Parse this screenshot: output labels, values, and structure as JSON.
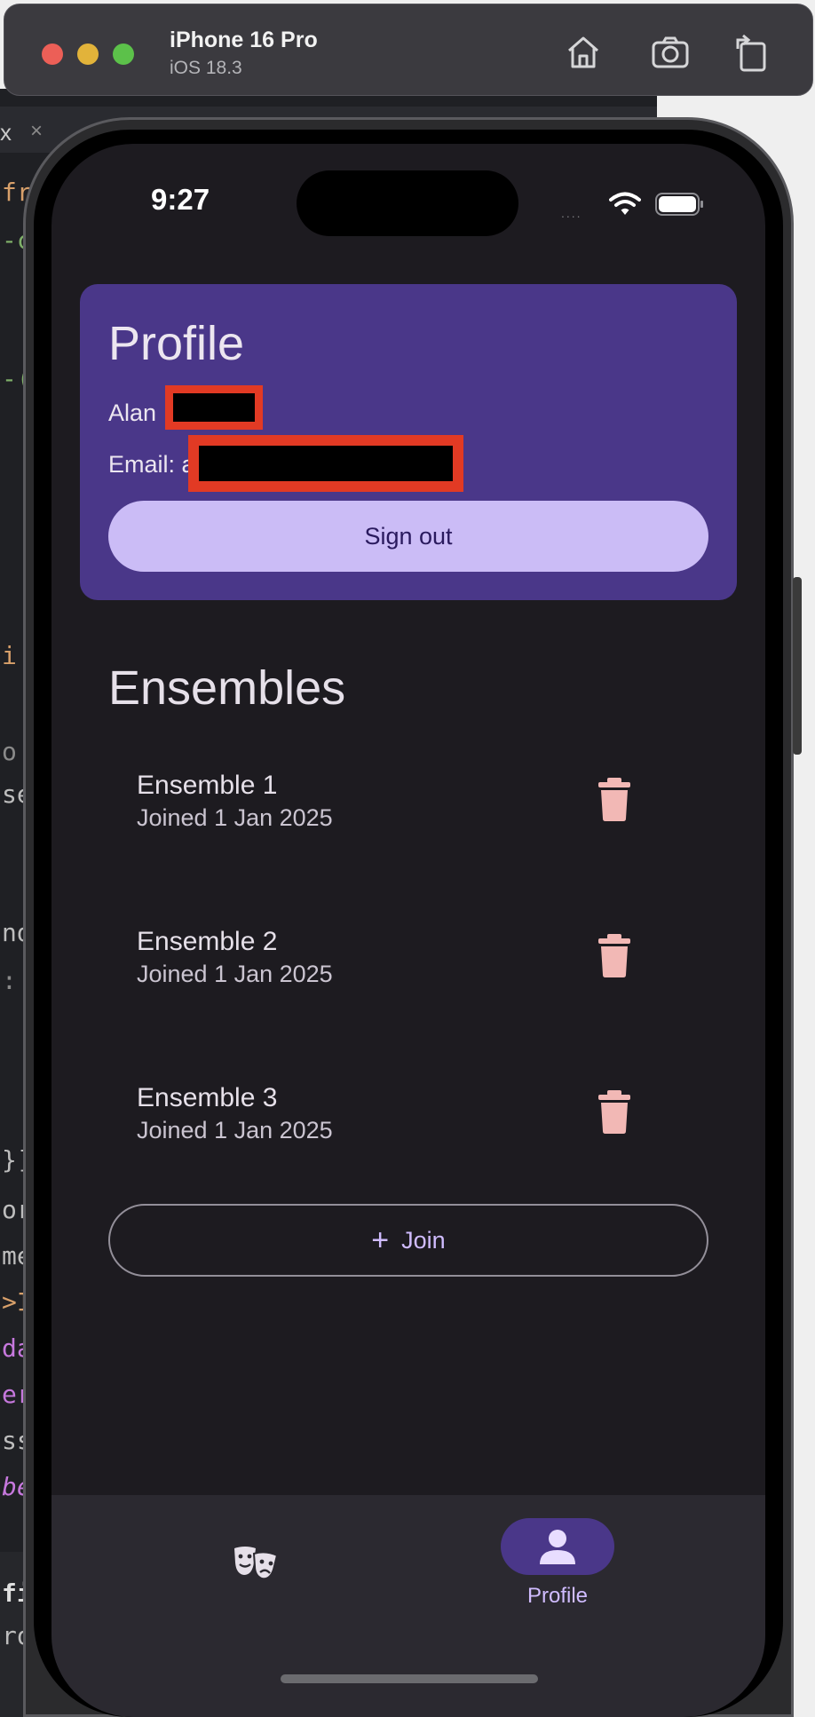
{
  "window": {
    "device_name": "iPhone 16 Pro",
    "os_version": "iOS 18.3",
    "toolbar_icons": [
      "home-icon",
      "screenshot-icon",
      "rotate-icon"
    ]
  },
  "background_editor": {
    "tab_label": "x",
    "tab_close": "×",
    "code_fragments": [
      "fr",
      "-c",
      "-(",
      "i",
      "o",
      "se",
      "nd",
      ":",
      "}]",
      "or",
      "me",
      ">I",
      "da",
      "er",
      "ss",
      "be",
      "file",
      "rofi"
    ]
  },
  "status_bar": {
    "time": "9:27",
    "signal": "....",
    "wifi_icon": "wifi-icon",
    "battery_icon": "battery-icon"
  },
  "profile": {
    "title": "Profile",
    "name_label": "Alan",
    "email_label": "Email: a",
    "signout_label": "Sign out"
  },
  "ensembles": {
    "title": "Ensembles",
    "items": [
      {
        "name": "Ensemble 1",
        "joined": "Joined 1 Jan 2025"
      },
      {
        "name": "Ensemble 2",
        "joined": "Joined 1 Jan 2025"
      },
      {
        "name": "Ensemble 3",
        "joined": "Joined 1 Jan 2025"
      }
    ],
    "join_label": "Join"
  },
  "bottom_nav": {
    "items": [
      {
        "icon": "theater-masks-icon",
        "label": ""
      },
      {
        "icon": "person-icon",
        "label": "Profile",
        "selected": true
      }
    ]
  },
  "colors": {
    "card": "#4a3789",
    "signout_button": "#cbbcf6",
    "surface": "#1d1b20",
    "accent": "#d0bcff",
    "trash": "#f2b8b5",
    "redaction_border": "#e23a24"
  }
}
